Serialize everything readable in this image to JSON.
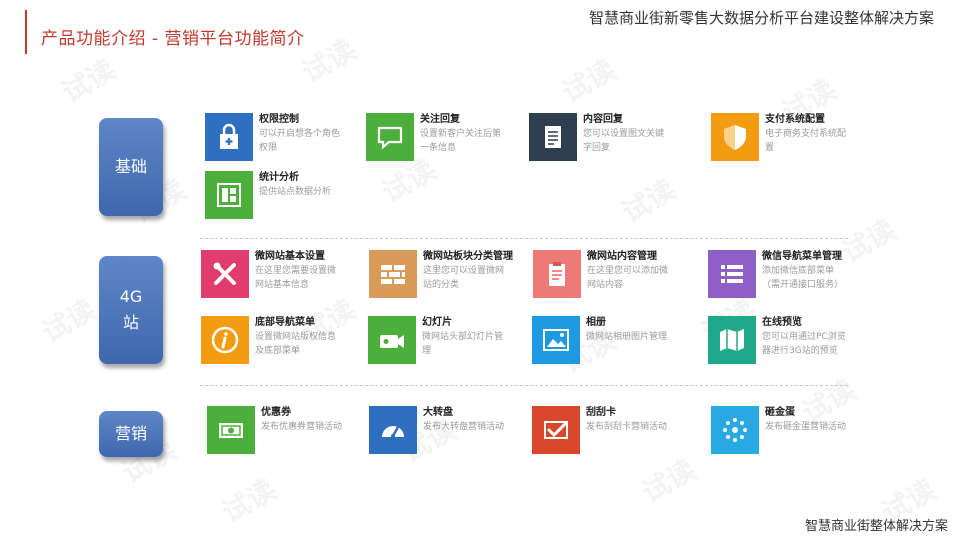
{
  "header": {
    "section_title": "产品功能介绍 - 营销平台功能简介"
  },
  "doc_title": "智慧商业街新零售大数据分析平台建设整体解决方案",
  "footer": "智慧商业街整体解决方案",
  "watermark": "试读",
  "categories": [
    {
      "label": "基础"
    },
    {
      "label": "4G\n站"
    },
    {
      "label": "营销"
    }
  ],
  "basics": [
    {
      "title": "权限控制",
      "desc": "可以开启想各个角色权限",
      "color": "#2f6fbf",
      "icon": "lock-icon"
    },
    {
      "title": "关注回复",
      "desc": "设置新客户关注后第一条信息",
      "color": "#4caf3c",
      "icon": "chat-bubble-icon"
    },
    {
      "title": "内容回复",
      "desc": "您可以设置图文关键字回复",
      "color": "#2f3e4e",
      "icon": "document-icon"
    },
    {
      "title": "支付系统配置",
      "desc": "电子商务支付系统配置",
      "color": "#f39c12",
      "icon": "shield-icon"
    },
    {
      "title": "统计分析",
      "desc": "提供站点数据分析",
      "color": "#4caf3c",
      "icon": "stats-icon"
    }
  ],
  "site4g": [
    {
      "title": "微网站基本设置",
      "desc": "在这里您需要设置微网站基本信息",
      "color": "#e03c6e",
      "icon": "tools-icon"
    },
    {
      "title": "微网站板块分类管理",
      "desc": "这里您可以设置微网站的分类",
      "color": "#d89b5a",
      "icon": "brick-wall-icon"
    },
    {
      "title": "微网站内容管理",
      "desc": "在这里您可以添加微网站内容",
      "color": "#ee7a78",
      "icon": "clipboard-icon"
    },
    {
      "title": "微信导航菜单管理",
      "desc": "添加微信底部菜单（需开通接口服务）",
      "color": "#8e5fc7",
      "icon": "menu-list-icon"
    },
    {
      "title": "底部导航菜单",
      "desc": "设置微网站版权信息及底部菜单",
      "color": "#f39c12",
      "icon": "info-icon"
    },
    {
      "title": "幻灯片",
      "desc": "微网站头部幻灯片管理",
      "color": "#4caf3c",
      "icon": "projector-icon"
    },
    {
      "title": "相册",
      "desc": "微网站相册图片管理",
      "color": "#1e9be0",
      "icon": "photo-icon"
    },
    {
      "title": "在线预览",
      "desc": "您可以用通过PC浏览器进行3G站的预览",
      "color": "#1fa88a",
      "icon": "map-icon"
    }
  ],
  "marketing": [
    {
      "title": "优惠券",
      "desc": "发布优惠券营销活动",
      "color": "#4caf3c",
      "icon": "coupon-icon"
    },
    {
      "title": "大转盘",
      "desc": "发布大转盘营销活动",
      "color": "#2f6fbf",
      "icon": "gauge-icon"
    },
    {
      "title": "刮刮卡",
      "desc": "发布刮刮卡营销活动",
      "color": "#d9472b",
      "icon": "check-card-icon"
    },
    {
      "title": "砸金蛋",
      "desc": "发布砸金蛋营销活动",
      "color": "#29a9e1",
      "icon": "sparkle-icon"
    }
  ]
}
